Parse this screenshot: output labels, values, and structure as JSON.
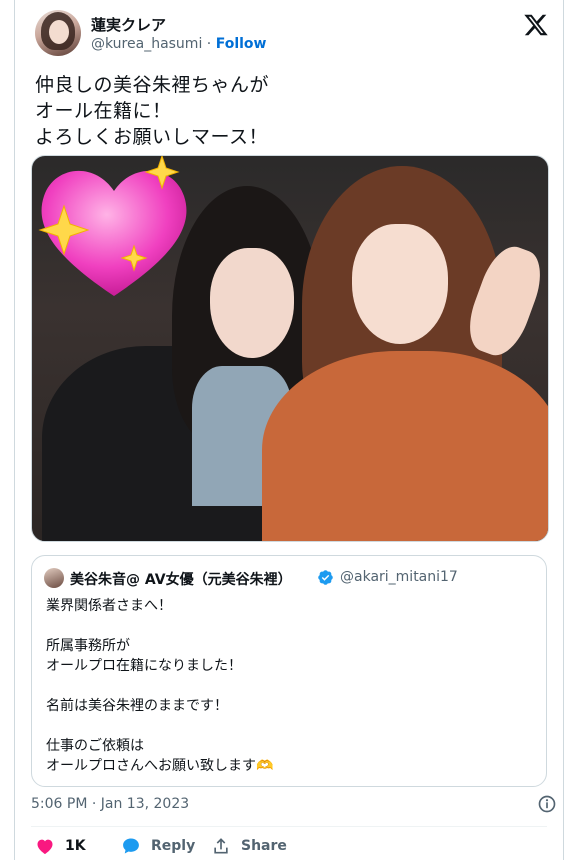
{
  "author": {
    "name": "蓮実クレア",
    "handle": "@kurea_hasumi",
    "separator": "·",
    "follow_label": "Follow"
  },
  "tweet": {
    "lines": [
      "仲良しの美谷朱裡ちゃんが",
      "オール在籍に！",
      "よろしくお願いしマース！"
    ]
  },
  "quoted": {
    "name": "美谷朱音@ AV女優（元美谷朱裡）",
    "handle": "@akari_mitani17",
    "body": "業界関係者さまへ！\n\n所属事務所が\nオールプロ在籍になりました！\n\n名前は美谷朱裡のままです！\n\n仕事のご依頼は\nオールプロさんへお願い致します🫶"
  },
  "timestamp": "5:06 PM · Jan 13, 2023",
  "actions": {
    "like_count": "1K",
    "reply_label": "Reply",
    "share_label": "Share"
  },
  "icons": {
    "x_logo": "x-logo-icon",
    "verified": "verified-badge-icon",
    "info": "info-icon",
    "heart": "heart-icon",
    "reply": "reply-bubble-icon",
    "share": "share-icon"
  },
  "colors": {
    "accent": "#006fd6",
    "like": "#f91880",
    "verified": "#1d9bf0",
    "secondary_text": "#536471"
  }
}
